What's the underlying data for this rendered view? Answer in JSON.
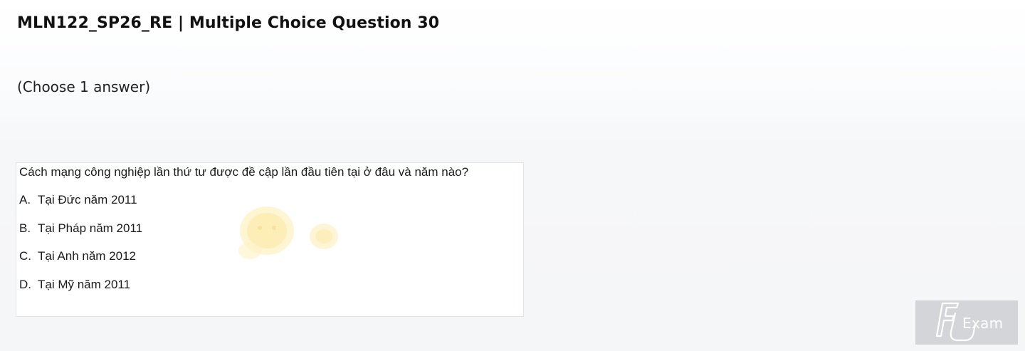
{
  "header": {
    "title": "MLN122_SP26_RE | Multiple Choice Question 30",
    "instruction": "(Choose 1 answer)"
  },
  "question": {
    "text": "Cách mạng công nghiệp lần thứ tư được đề cập lần đầu tiên tại ở đâu và năm nào?",
    "options": [
      {
        "letter": "A.",
        "text": "Tại Đức năm 2011"
      },
      {
        "letter": "B.",
        "text": "Tại Pháp năm 2011"
      },
      {
        "letter": "C.",
        "text": "Tại Anh năm 2012"
      },
      {
        "letter": "D.",
        "text": "Tại Mỹ năm 2011"
      }
    ]
  },
  "logo": {
    "text": "Exam",
    "icon": "fu-logo-icon"
  },
  "colors": {
    "card_border": "#dfe2e6",
    "logo_background": "#d3d5d9",
    "watermark": "#fbe7a1"
  }
}
